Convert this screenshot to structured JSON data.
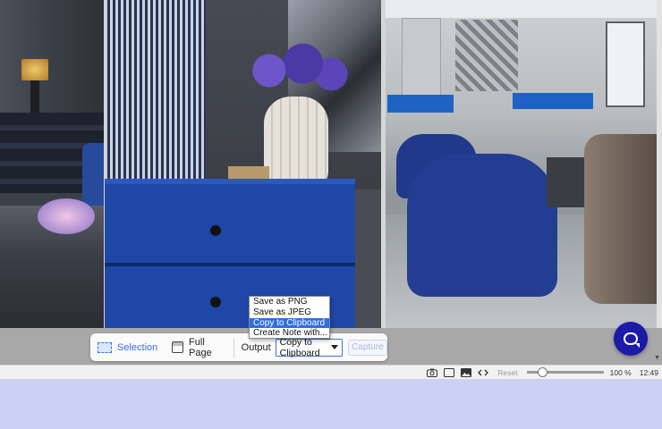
{
  "capture_toolbar": {
    "selection_label": "Selection",
    "fullpage_label": "Full Page",
    "output_label": "Output",
    "output_selected": "Copy to Clipboard",
    "capture_label": "Capture"
  },
  "output_dropdown": {
    "options": [
      "Save as PNG",
      "Save as JPEG",
      "Copy to Clipboard",
      "Create Note with..."
    ],
    "highlighted": "Copy to Clipboard"
  },
  "statusbar": {
    "reset_label": "Reset",
    "zoom": "100 %",
    "time": "12:49"
  },
  "icons": {
    "selection": "dashed-rectangle-icon",
    "fullpage": "browser-window-icon",
    "chat": "chat-bubble-icon",
    "status": [
      "camera-icon",
      "window-icon",
      "image-icon",
      "code-icon"
    ]
  },
  "colors": {
    "accent": "#3b6ee8",
    "chat_button": "#1c1aa8",
    "highlight": "#2f6fde",
    "background": "#ccd0f4"
  }
}
